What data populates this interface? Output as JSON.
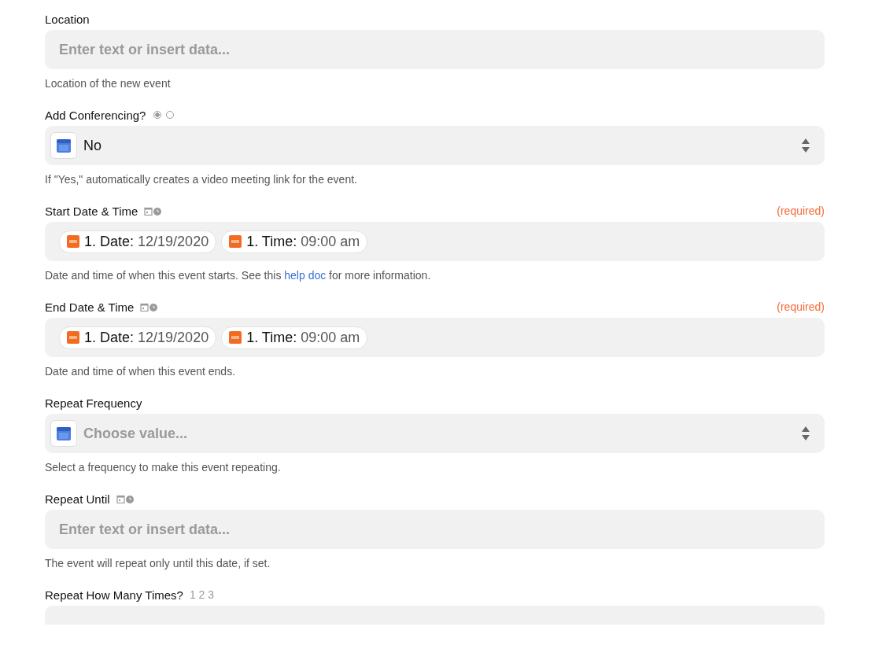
{
  "fields": [
    {
      "kind": "text",
      "label": "Location",
      "placeholder": "Enter text or insert data...",
      "help": "Location of the new event"
    },
    {
      "kind": "select",
      "label": "Add Conferencing?",
      "toggle": [
        {
          "selected": true
        },
        {
          "selected": false
        }
      ],
      "value": "No",
      "help": "If \"Yes,\" automatically creates a video meeting link for the event."
    },
    {
      "kind": "pills",
      "label": "Start Date & Time",
      "date_time_hint": true,
      "required": "(required)",
      "pills": [
        {
          "step": "1. Date:",
          "value": "12/19/2020"
        },
        {
          "step": "1. Time:",
          "value": "09:00 am"
        }
      ],
      "help": "Date and time of when this event starts. See this",
      "help_link": "help doc",
      "help_after": "for more information."
    },
    {
      "kind": "pills",
      "label": "End Date & Time",
      "date_time_hint": true,
      "required": "(required)",
      "pills": [
        {
          "step": "1. Date:",
          "value": "12/19/2020"
        },
        {
          "step": "1. Time:",
          "value": "09:00 am"
        }
      ],
      "help": "Date and time of when this event ends."
    },
    {
      "kind": "select",
      "label": "Repeat Frequency",
      "placeholder": "Choose value...",
      "help": "Select a frequency to make this event repeating."
    },
    {
      "kind": "text",
      "label": "Repeat Until",
      "date_time_hint": true,
      "placeholder": "Enter text or insert data...",
      "help": "The event will repeat only until this date, if set."
    },
    {
      "kind": "text",
      "label": "Repeat How Many Times?",
      "hint_text": "1 2 3"
    }
  ]
}
